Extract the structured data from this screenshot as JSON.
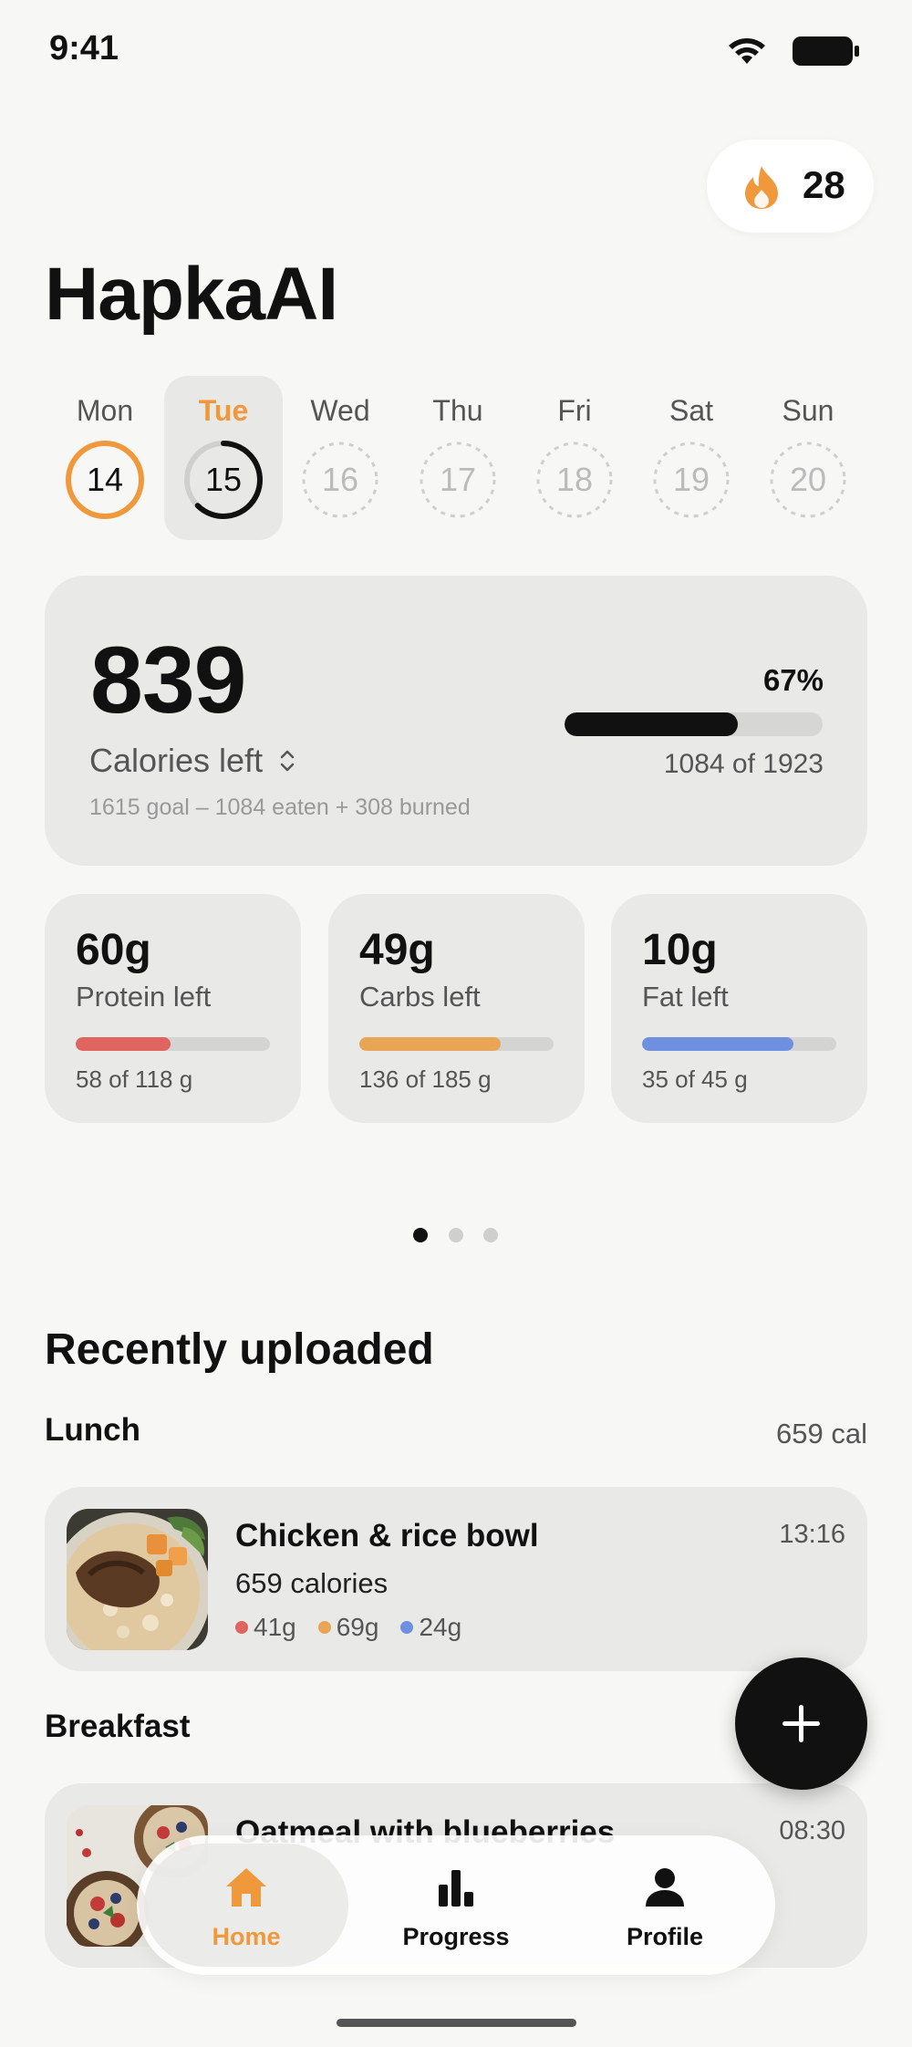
{
  "status": {
    "time": "9:41"
  },
  "streak": {
    "count": "28"
  },
  "app_title": "HapkaAI",
  "week": [
    {
      "label": "Mon",
      "date": "14",
      "state": "done"
    },
    {
      "label": "Tue",
      "date": "15",
      "state": "selected"
    },
    {
      "label": "Wed",
      "date": "16",
      "state": "future"
    },
    {
      "label": "Thu",
      "date": "17",
      "state": "future"
    },
    {
      "label": "Fri",
      "date": "18",
      "state": "future"
    },
    {
      "label": "Sat",
      "date": "19",
      "state": "future"
    },
    {
      "label": "Sun",
      "date": "20",
      "state": "future"
    }
  ],
  "calories": {
    "left": "839",
    "label": "Calories left",
    "breakdown": "1615 goal – 1084 eaten + 308 burned",
    "percent_text": "67%",
    "progress": 0.67,
    "fraction": "1084 of 1923"
  },
  "macros": [
    {
      "value": "60g",
      "label": "Protein left",
      "fraction": "58 of 118 g",
      "progress": 0.49,
      "color": "#e06460"
    },
    {
      "value": "49g",
      "label": "Carbs left",
      "fraction": "136 of 185 g",
      "progress": 0.73,
      "color": "#e8a555"
    },
    {
      "value": "10g",
      "label": "Fat left",
      "fraction": "35 of 45 g",
      "progress": 0.78,
      "color": "#6f8fe0"
    }
  ],
  "pager": {
    "count": 3,
    "active": 0
  },
  "recent": {
    "title": "Recently uploaded",
    "meals": [
      {
        "label": "Lunch",
        "total": "659 cal",
        "item": {
          "name": "Chicken & rice bowl",
          "time": "13:16",
          "calories": "659 calories",
          "protein": "41g",
          "carbs": "69g",
          "fat": "24g"
        }
      },
      {
        "label": "Breakfast",
        "total": "",
        "item": {
          "name": "Oatmeal with blueberries",
          "time": "08:30",
          "calories": "",
          "protein": "",
          "carbs": "",
          "fat": ""
        }
      }
    ]
  },
  "tabs": [
    {
      "label": "Home",
      "icon": "house-icon",
      "active": true
    },
    {
      "label": "Progress",
      "icon": "bar-chart-icon",
      "active": false
    },
    {
      "label": "Profile",
      "icon": "person-icon",
      "active": false
    }
  ],
  "colors": {
    "accent": "#f0983c",
    "protein": "#e06460",
    "carbs": "#e8a555",
    "fat": "#6f8fe0"
  }
}
